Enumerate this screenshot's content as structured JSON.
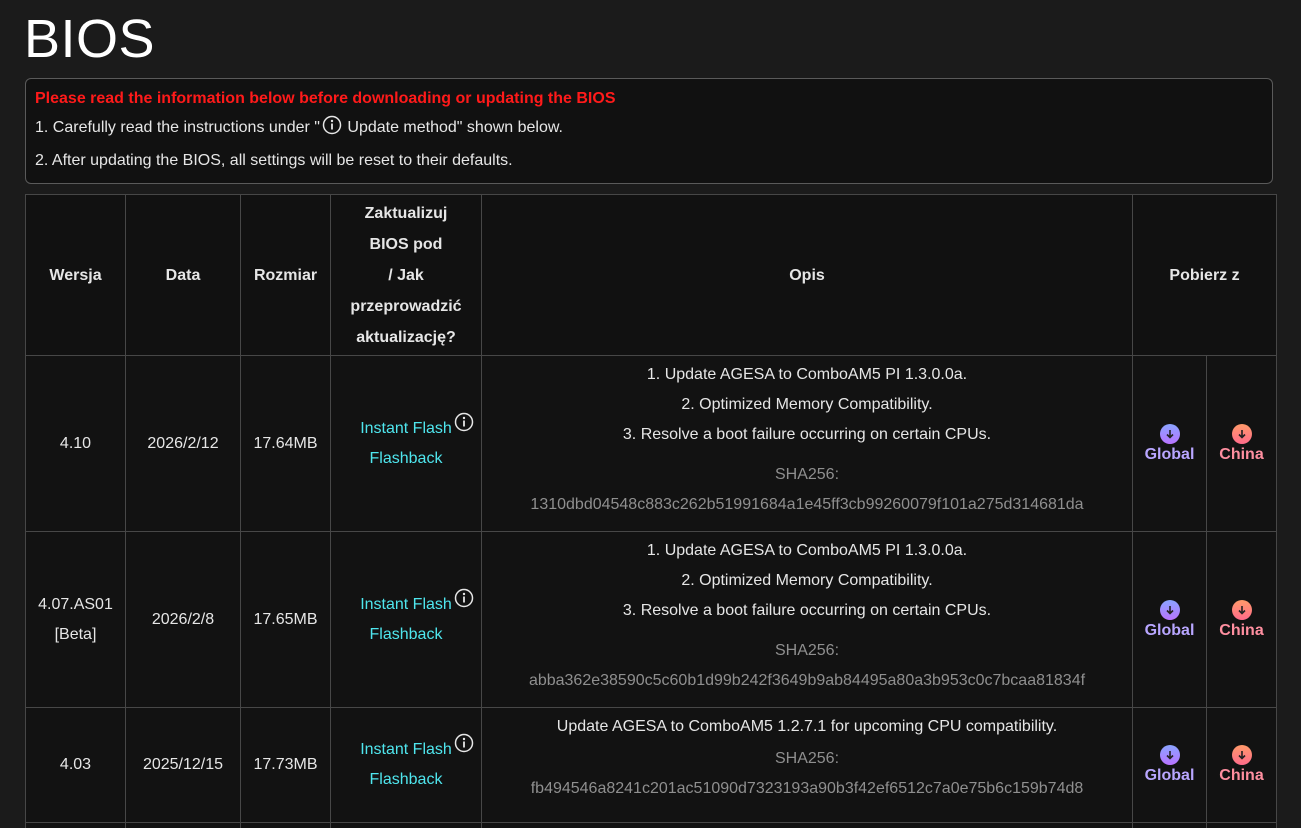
{
  "page_title": "BIOS",
  "notice": {
    "warning": "Please read the information below before downloading or updating the BIOS",
    "line1_before": "1. Carefully read the instructions under \"",
    "line1_after": " Update method\" shown below.",
    "line2": "2. After updating the BIOS, all settings will be reset to their defaults."
  },
  "table": {
    "headers": {
      "version": "Wersja",
      "date": "Data",
      "size": "Rozmiar",
      "update_lines": [
        "Zaktualizuj",
        "BIOS pod",
        "/ Jak",
        "przeprowadzić",
        "aktualizację?"
      ],
      "description": "Opis",
      "download": "Pobierz z"
    },
    "rows": [
      {
        "version": "4.10",
        "version_tag": "",
        "date": "2026/2/12",
        "size": "17.64MB",
        "method1": "Instant Flash",
        "method2": "Flashback",
        "desc": [
          "1. Update AGESA to ComboAM5 PI 1.3.0.0a.",
          "2. Optimized Memory Compatibility.",
          "3. Resolve a boot failure occurring on certain CPUs."
        ],
        "sha_label": "SHA256:",
        "sha": "1310dbd04548c883c262b51991684a1e45ff3cb99260079f101a275d314681da",
        "global": "Global",
        "china": "China"
      },
      {
        "version": "4.07.AS01",
        "version_tag": "[Beta]",
        "date": "2026/2/8",
        "size": "17.65MB",
        "method1": "Instant Flash",
        "method2": "Flashback",
        "desc": [
          "1. Update AGESA to ComboAM5 PI 1.3.0.0a.",
          "2. Optimized Memory Compatibility.",
          "3. Resolve a boot failure occurring on certain CPUs."
        ],
        "sha_label": "SHA256:",
        "sha": "abba362e38590c5c60b1d99b242f3649b9ab84495a80a3b953c0c7bcaa81834f",
        "global": "Global",
        "china": "China"
      },
      {
        "version": "4.03",
        "version_tag": "",
        "date": "2025/12/15",
        "size": "17.73MB",
        "method1": "Instant Flash",
        "method2": "Flashback",
        "desc": [
          "Update AGESA to ComboAM5 1.2.7.1 for upcoming CPU compatibility."
        ],
        "sha_label": "SHA256:",
        "sha": "fb494546a8241c201ac51090d7323193a90b3f42ef6512c7a0e75b6c159b74d8",
        "global": "Global",
        "china": "China"
      }
    ]
  },
  "icons": {
    "info": "info-icon",
    "download": "download-arrow-icon"
  },
  "colors": {
    "warning": "#ff1a1a",
    "link": "#4fe6ee",
    "global": "#b8a6ff",
    "china": "#ff8fa0"
  }
}
